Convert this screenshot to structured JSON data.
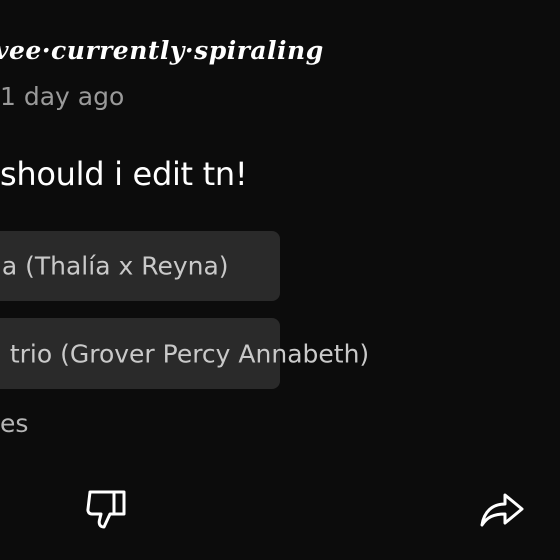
{
  "post": {
    "author": "vee·currently·spiraling",
    "timestamp": "1 day ago",
    "text": "should i edit tn!"
  },
  "poll": {
    "options": [
      {
        "label": "na (Thalía x Reyna)"
      },
      {
        "label": "g trio (Grover Percy Annabeth)"
      }
    ],
    "votes_label": "es"
  },
  "actions": {
    "dislike_icon": "thumbs-down-icon",
    "share_icon": "share-arrow-icon"
  }
}
